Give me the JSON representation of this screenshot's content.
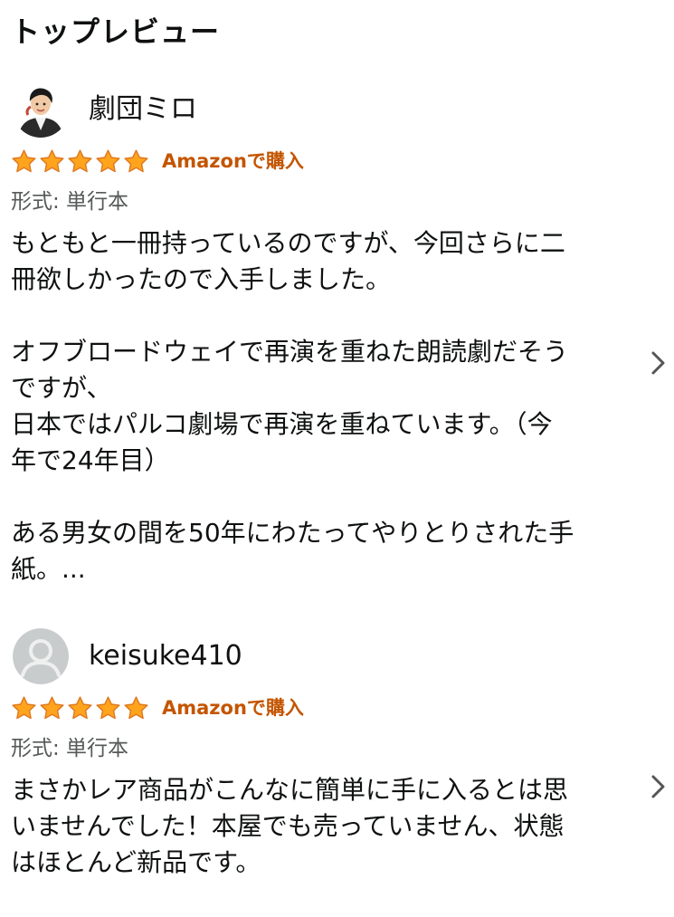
{
  "page": {
    "title": "トップレビュー"
  },
  "reviews": [
    {
      "reviewer": "劇団ミロ",
      "avatar_icon": "reviewer-photo-avatar",
      "rating": 5,
      "rating_max": 5,
      "badge": "Amazonで購入",
      "format": "形式: 単行本",
      "paragraphs": [
        [
          "もともと一冊持っているのですが、今回さらに二",
          "冊欲しかったので入手しました。"
        ],
        [
          "オフブロードウェイで再演を重ねた朗読劇だそう",
          "ですが、",
          "日本ではパルコ劇場で再演を重ねています。（今",
          "年で24年目）"
        ],
        [
          "ある男女の間を50年にわたってやりとりされた手",
          "紙。..."
        ]
      ],
      "chevron_icon": "chevron-right-icon"
    },
    {
      "reviewer": "keisuke410",
      "avatar_icon": "default-user-avatar",
      "rating": 5,
      "rating_max": 5,
      "badge": "Amazonで購入",
      "format": "形式: 単行本",
      "paragraphs": [
        [
          "まさかレア商品がこんなに簡単に手に入るとは思",
          "いませんでした！本屋でも売っていません、状態",
          "はほとんど新品です。"
        ]
      ],
      "chevron_icon": "chevron-right-icon"
    }
  ],
  "colors": {
    "star_fill": "#ffa41c",
    "star_stroke": "#de7921",
    "badge": "#c45500",
    "secondary_text": "#565959",
    "default_avatar_bg": "#c8cccd",
    "default_avatar_fg": "#eef0f0"
  }
}
